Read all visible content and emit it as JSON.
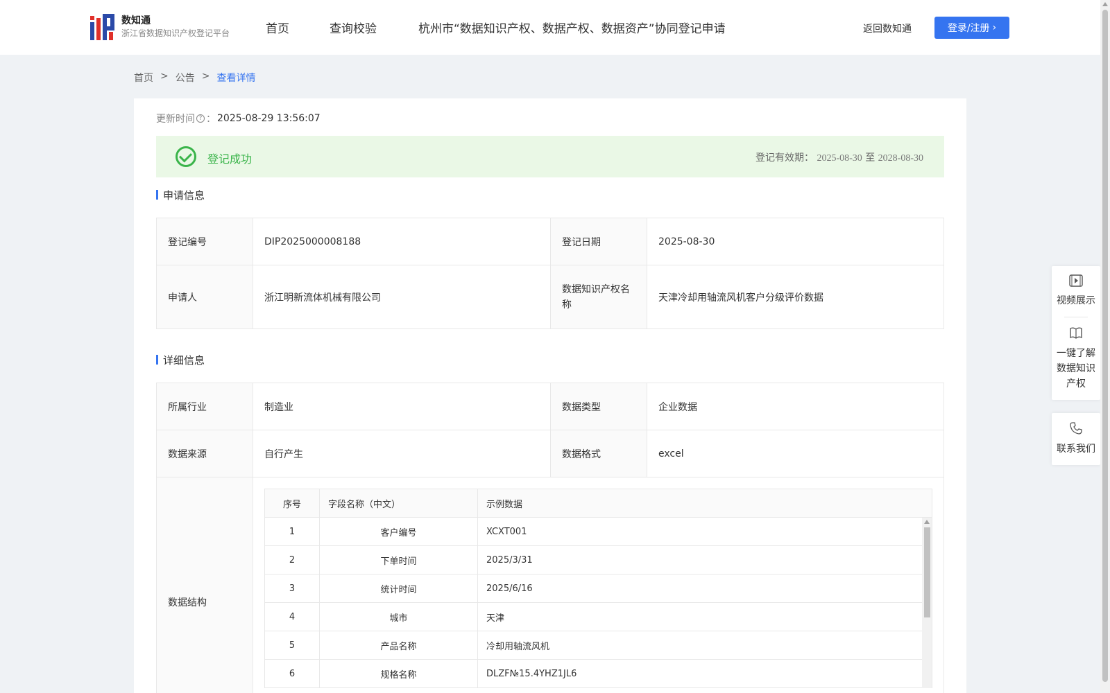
{
  "header": {
    "logo_title": "数知通",
    "logo_sub": "浙江省数据知识产权登记平台",
    "nav": [
      "首页",
      "查询校验",
      "杭州市“数据知识产权、数据产权、数据资产”协同登记申请"
    ],
    "return_label": "返回数知通",
    "login_label": "登录/注册"
  },
  "breadcrumb": {
    "home": "首页",
    "sep": ">",
    "notice": "公告",
    "current": "查看详情"
  },
  "update": {
    "label": "更新时间",
    "colon": "：",
    "value": "2025-08-29 13:56:07"
  },
  "status": {
    "text": "登记成功",
    "validity_label": "登记有效期：",
    "start": "2025-08-30",
    "to": "至",
    "end": "2028-08-30"
  },
  "application": {
    "title": "申请信息",
    "reg_no_label": "登记编号",
    "reg_no": "DIP2025000008188",
    "reg_date_label": "登记日期",
    "reg_date": "2025-08-30",
    "applicant_label": "申请人",
    "applicant": "浙江明新流体机械有限公司",
    "ip_name_label": "数据知识产权名称",
    "ip_name": "天津冷却用轴流风机客户分级评价数据"
  },
  "detail": {
    "title": "详细信息",
    "industry_label": "所属行业",
    "industry": "制造业",
    "data_type_label": "数据类型",
    "data_type": "企业数据",
    "source_label": "数据来源",
    "source": "自行产生",
    "format_label": "数据格式",
    "format": "excel",
    "structure_label": "数据结构",
    "structure": {
      "headers": [
        "序号",
        "字段名称（中文）",
        "示例数据"
      ],
      "rows": [
        [
          "1",
          "客户编号",
          "XCXT001"
        ],
        [
          "2",
          "下单时间",
          "2025/3/31"
        ],
        [
          "3",
          "统计时间",
          "2025/6/16"
        ],
        [
          "4",
          "城市",
          "天津"
        ],
        [
          "5",
          "产品名称",
          "冷却用轴流风机"
        ],
        [
          "6",
          "规格名称",
          "DLZF№15.4YHZ1JL6"
        ]
      ]
    }
  },
  "float": {
    "video": "视频展示",
    "learn": "一键了解数据知识产权",
    "contact": "联系我们"
  },
  "colors": {
    "accent": "#3574f0",
    "success": "#3ab44a",
    "success_bg": "#eaf8e6"
  }
}
